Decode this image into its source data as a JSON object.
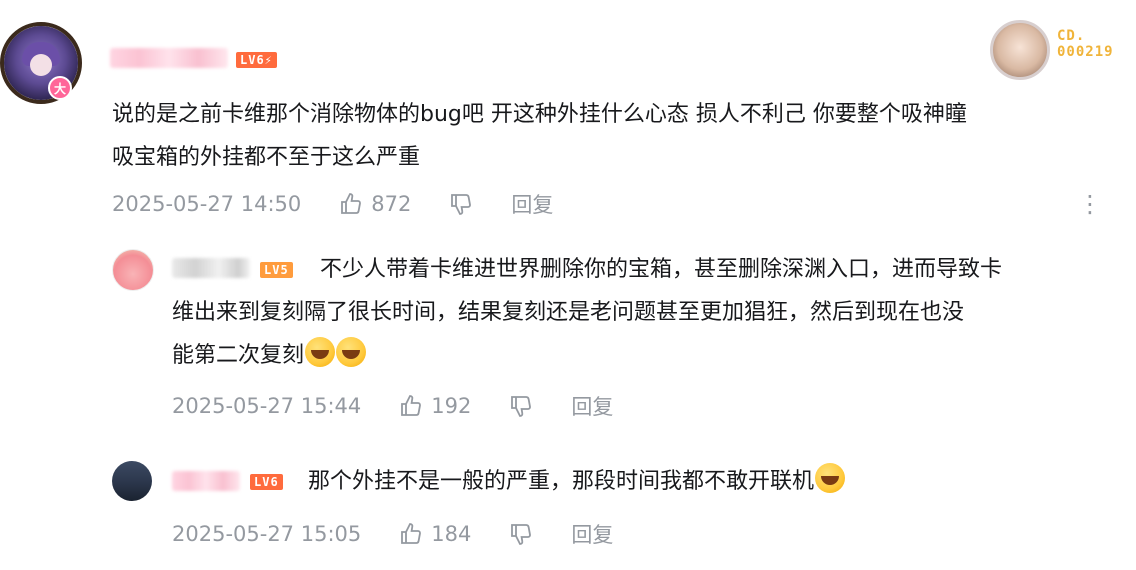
{
  "main_comment": {
    "level": "LV6⚡",
    "vip_badge": "大",
    "text_line1": "说的是之前卡维那个消除物体的bug吧 开这种外挂什么心态 损人不利己 你要整个吸神瞳",
    "text_line2": "吸宝箱的外挂都不至于这么严重",
    "date": "2025-05-27 14:50",
    "likes": "872",
    "reply_label": "回复",
    "more_icon": "more-vertical-icon",
    "decoration": {
      "line1": "CD.",
      "line2": "000219"
    }
  },
  "replies": [
    {
      "level": "LV5",
      "text_line1": "不少人带着卡维进世界删除你的宝箱，甚至删除深渊入口，进而导致卡",
      "text_line2": "维出来到复刻隔了很长时间，结果复刻还是老问题甚至更加猖狂，然后到现在也没",
      "text_line3": "能第二次复刻",
      "emojis": [
        "cry-laugh-emoji",
        "cry-laugh-emoji"
      ],
      "date": "2025-05-27 15:44",
      "likes": "192",
      "reply_label": "回复"
    },
    {
      "level": "LV6",
      "text": "那个外挂不是一般的严重，那段时间我都不敢开联机",
      "emojis": [
        "cry-laugh-emoji"
      ],
      "date": "2025-05-27 15:05",
      "likes": "184",
      "reply_label": "回复"
    }
  ],
  "colors": {
    "text": "#18191c",
    "meta": "#9499a0",
    "lv6": "#ff6b3d",
    "lv5": "#ff9c3d",
    "vip_pink": "#ff6699",
    "decor_gold": "#f0b43a"
  }
}
